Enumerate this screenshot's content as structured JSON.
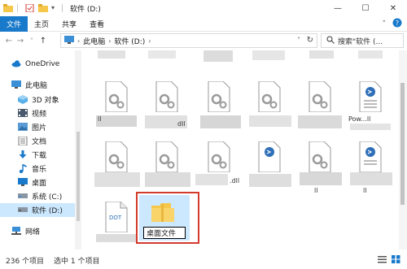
{
  "window": {
    "title": "软件 (D:)",
    "controls": {
      "minimize": "—",
      "maximize": "☐",
      "close": "✕"
    }
  },
  "ribbon": {
    "tabs": [
      "文件",
      "主页",
      "共享",
      "查看"
    ]
  },
  "address": {
    "crumbs": [
      "此电脑",
      "软件 (D:)"
    ],
    "separator": "›",
    "search_placeholder": "搜索\"软件 (...",
    "back": "←",
    "forward": "→",
    "recent": "˅",
    "up": "↑",
    "refresh": "↻"
  },
  "sidebar": {
    "items": [
      {
        "label": "OneDrive",
        "icon": "cloud-icon"
      },
      {
        "label": "此电脑",
        "icon": "computer-icon"
      },
      {
        "label": "3D 对象",
        "icon": "cube-icon"
      },
      {
        "label": "视频",
        "icon": "video-icon"
      },
      {
        "label": "图片",
        "icon": "picture-icon"
      },
      {
        "label": "文档",
        "icon": "document-icon"
      },
      {
        "label": "下载",
        "icon": "download-icon"
      },
      {
        "label": "音乐",
        "icon": "music-icon"
      },
      {
        "label": "桌面",
        "icon": "desktop-icon"
      },
      {
        "label": "系统 (C:)",
        "icon": "drive-icon"
      },
      {
        "label": "软件 (D:)",
        "icon": "drive-icon",
        "selected": true
      },
      {
        "label": "网络",
        "icon": "network-icon"
      }
    ]
  },
  "files": {
    "row1_labels": [
      "ll",
      "dll",
      "",
      "",
      "",
      "",
      "Pow...ll",
      ""
    ],
    "row2_labels": [
      "",
      "",
      ".dll",
      "",
      "",
      "ll",
      "ll"
    ],
    "dot_label": "DOT",
    "new_folder_name": "桌面文件"
  },
  "status": {
    "count": "236 个项目",
    "selected": "选中 1 个项目"
  },
  "colors": {
    "accent": "#1979ca",
    "highlight_box": "#d33a2c",
    "selection": "#cce8ff",
    "folder": "#f5c74a"
  }
}
